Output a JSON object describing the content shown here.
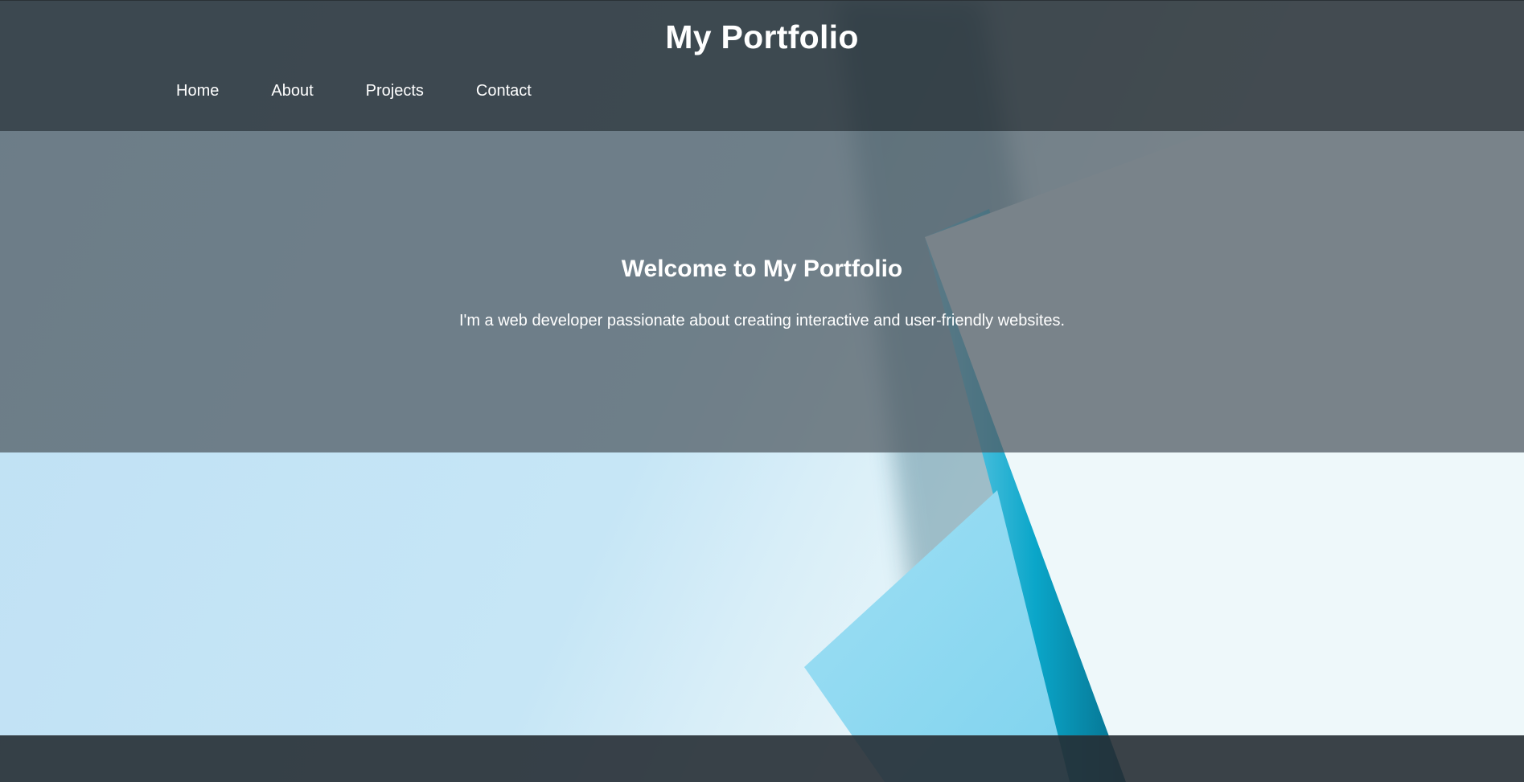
{
  "header": {
    "title": "My Portfolio",
    "nav": [
      {
        "label": "Home"
      },
      {
        "label": "About"
      },
      {
        "label": "Projects"
      },
      {
        "label": "Contact"
      }
    ]
  },
  "hero": {
    "title": "Welcome to My Portfolio",
    "text": "I'm a web developer passionate about creating interactive and user-friendly websites."
  },
  "colors": {
    "header_bg": "#262e34",
    "hero_overlay": "#505a62",
    "background_light_blue": "#c6e6f6",
    "accent_teal": "#0aa6c9",
    "text": "#ffffff"
  }
}
